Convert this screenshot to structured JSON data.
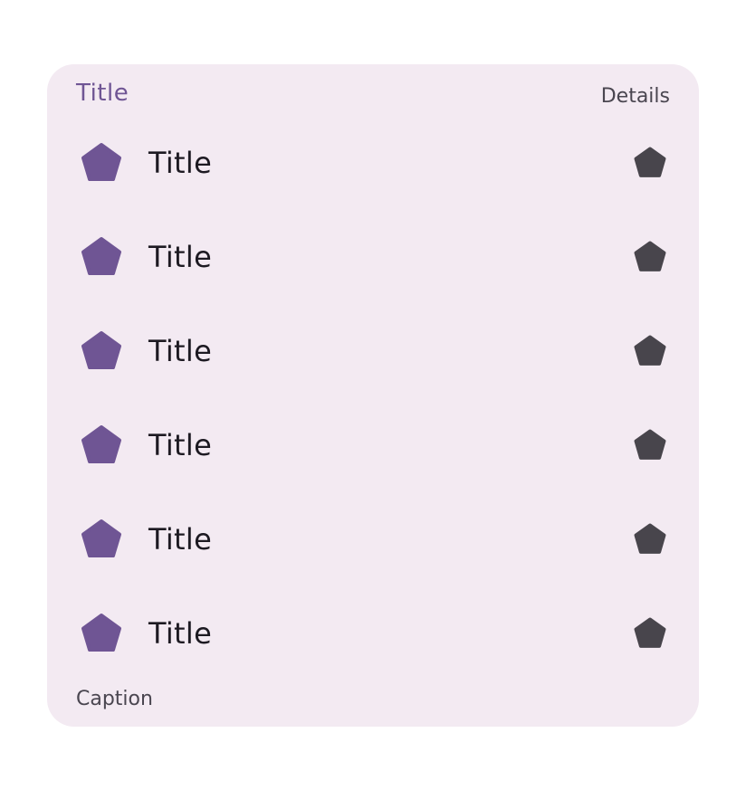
{
  "card": {
    "header": {
      "title": "Title",
      "details": "Details"
    },
    "items": [
      {
        "label": "Title",
        "leading_icon": "pentagon-icon",
        "trailing_icon": "pentagon-icon"
      },
      {
        "label": "Title",
        "leading_icon": "pentagon-icon",
        "trailing_icon": "pentagon-icon"
      },
      {
        "label": "Title",
        "leading_icon": "pentagon-icon",
        "trailing_icon": "pentagon-icon"
      },
      {
        "label": "Title",
        "leading_icon": "pentagon-icon",
        "trailing_icon": "pentagon-icon"
      },
      {
        "label": "Title",
        "leading_icon": "pentagon-icon",
        "trailing_icon": "pentagon-icon"
      },
      {
        "label": "Title",
        "leading_icon": "pentagon-icon",
        "trailing_icon": "pentagon-icon"
      }
    ],
    "caption": "Caption"
  },
  "colors": {
    "card_background": "#f3eaf2",
    "accent": "#6f5594",
    "leading_icon": "#6f5594",
    "trailing_icon": "#48454c",
    "text_primary": "#1d1a22",
    "text_secondary": "#4a4650"
  }
}
